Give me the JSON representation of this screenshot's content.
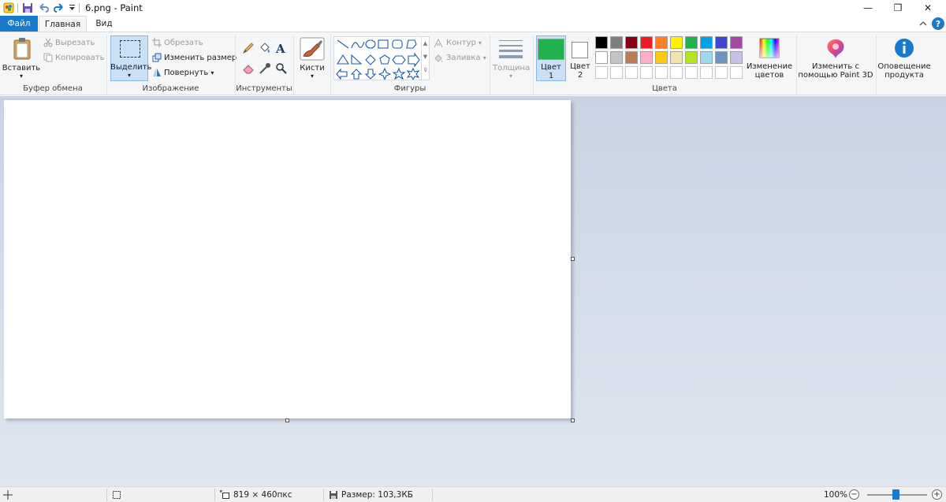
{
  "window": {
    "title": "6.png - Paint",
    "minimize_icon": "—",
    "restore_icon": "❐",
    "close_icon": "✕"
  },
  "tabs": {
    "file": "Файл",
    "home": "Главная",
    "view": "Вид"
  },
  "ribbon": {
    "clipboard": {
      "group_label": "Буфер обмена",
      "paste": "Вставить",
      "cut": "Вырезать",
      "copy": "Копировать"
    },
    "image": {
      "group_label": "Изображение",
      "select": "Выделить",
      "crop": "Обрезать",
      "resize": "Изменить размер",
      "rotate": "Повернуть"
    },
    "tools": {
      "group_label": "Инструменты"
    },
    "brushes": {
      "label": "Кисти"
    },
    "shapes": {
      "group_label": "Фигуры",
      "outline": "Контур",
      "fill": "Заливка"
    },
    "size": {
      "label": "Толщина"
    },
    "colors": {
      "group_label": "Цвета",
      "color1_line1": "Цвет",
      "color1_line2": "1",
      "color2_line1": "Цвет",
      "color2_line2": "2",
      "color1_value": "#22b14c",
      "color2_value": "#ffffff",
      "edit_line1": "Изменение",
      "edit_line2": "цветов",
      "palette_row1": [
        "#000000",
        "#7f7f7f",
        "#880015",
        "#ed1c24",
        "#ff7f27",
        "#fff200",
        "#22b14c",
        "#00a2e8",
        "#3f48cc",
        "#a349a4"
      ],
      "palette_row2": [
        "#ffffff",
        "#c3c3c3",
        "#b97a57",
        "#ffaec9",
        "#ffc90e",
        "#efe4b0",
        "#b5e61d",
        "#99d9ea",
        "#7092be",
        "#c8bfe7"
      ],
      "palette_row3": [
        "#ffffff",
        "#ffffff",
        "#ffffff",
        "#ffffff",
        "#ffffff",
        "#ffffff",
        "#ffffff",
        "#ffffff",
        "#ffffff",
        "#ffffff"
      ]
    },
    "paint3d": {
      "line1": "Изменить с",
      "line2": "помощью Paint 3D"
    },
    "alerts": {
      "line1": "Оповещение",
      "line2": "продукта"
    }
  },
  "status": {
    "dimensions": "819 × 460пкс",
    "file_size": "Размер: 103,3КБ",
    "zoom": "100%",
    "zoom_out": "−",
    "zoom_in": "+"
  },
  "icons": [
    "paint-app-icon",
    "save-icon",
    "undo-icon",
    "redo-icon",
    "customize-qat-icon",
    "paste-icon",
    "cut-icon",
    "copy-icon",
    "crop-icon",
    "resize-icon",
    "rotate-icon",
    "pencil-icon",
    "fill-bucket-icon",
    "text-icon",
    "eraser-icon",
    "color-picker-icon",
    "magnifier-icon",
    "brush-icon",
    "outline-icon",
    "fill-icon",
    "rainbow-icon",
    "paint3d-icon",
    "info-icon",
    "cursor-position-icon",
    "selection-size-icon",
    "image-size-icon",
    "disk-icon",
    "help-icon",
    "collapse-ribbon-icon"
  ]
}
